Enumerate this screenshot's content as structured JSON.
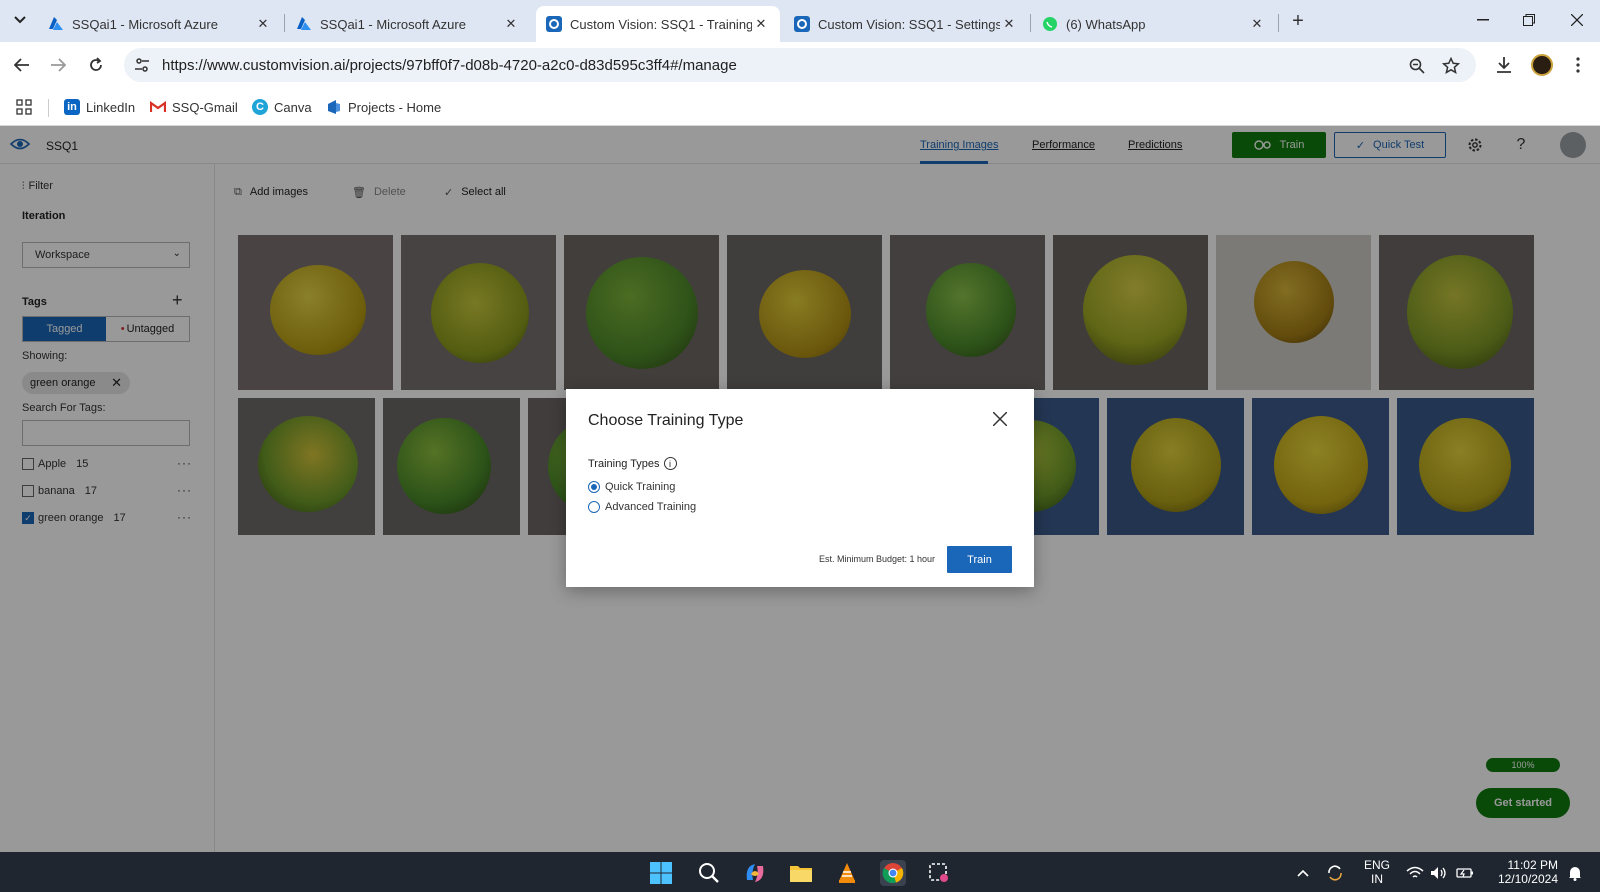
{
  "browser": {
    "tabs": [
      {
        "title": "SSQai1 - Microsoft Azure",
        "favicon": "azure-icon"
      },
      {
        "title": "SSQai1 - Microsoft Azure",
        "favicon": "azure-icon"
      },
      {
        "title": "Custom Vision: SSQ1 - Training",
        "favicon": "custom-vision-icon"
      },
      {
        "title": "Custom Vision: SSQ1 - Settings",
        "favicon": "custom-vision-icon"
      },
      {
        "title": "(6) WhatsApp",
        "favicon": "whatsapp-icon"
      }
    ],
    "url": "https://www.customvision.ai/projects/97bff0f7-d08b-4720-a2c0-d83d595c3ff4#/manage",
    "bookmarks": [
      {
        "label": "LinkedIn"
      },
      {
        "label": "SSQ-Gmail"
      },
      {
        "label": "Canva"
      },
      {
        "label": "Projects - Home"
      }
    ]
  },
  "app": {
    "project_name": "SSQ1",
    "nav": {
      "training_images": "Training Images",
      "performance": "Performance",
      "predictions": "Predictions"
    },
    "train_label": "Train",
    "quick_test_label": "Quick Test",
    "commands": {
      "add_images": "Add images",
      "delete": "Delete",
      "select_all": "Select all"
    },
    "accent": "#1a66b8",
    "green": "#107c10"
  },
  "sidebar": {
    "filter_label": "Filter",
    "iteration_label": "Iteration",
    "iteration_value": "Workspace",
    "tags_label": "Tags",
    "tagged_label": "Tagged",
    "untagged_label": "Untagged",
    "showing_label": "Showing:",
    "active_filter": "green orange",
    "search_label": "Search For Tags:",
    "tags": [
      {
        "name": "Apple",
        "count": "15",
        "checked": false
      },
      {
        "name": "banana",
        "count": "17",
        "checked": false
      },
      {
        "name": "green orange",
        "count": "17",
        "checked": true
      }
    ]
  },
  "dialog": {
    "title": "Choose Training Type",
    "types_label": "Training Types",
    "options": [
      {
        "label": "Quick Training",
        "selected": true
      },
      {
        "label": "Advanced Training",
        "selected": false
      }
    ],
    "budget_text": "Est. Minimum Budget: 1 hour",
    "train_label": "Train"
  },
  "widget": {
    "progress": "100%",
    "progress_fraction": 1.0,
    "get_started": "Get started"
  },
  "taskbar": {
    "lang_top": "ENG",
    "lang_bottom": "IN",
    "time": "11:02 PM",
    "date": "12/10/2024"
  }
}
